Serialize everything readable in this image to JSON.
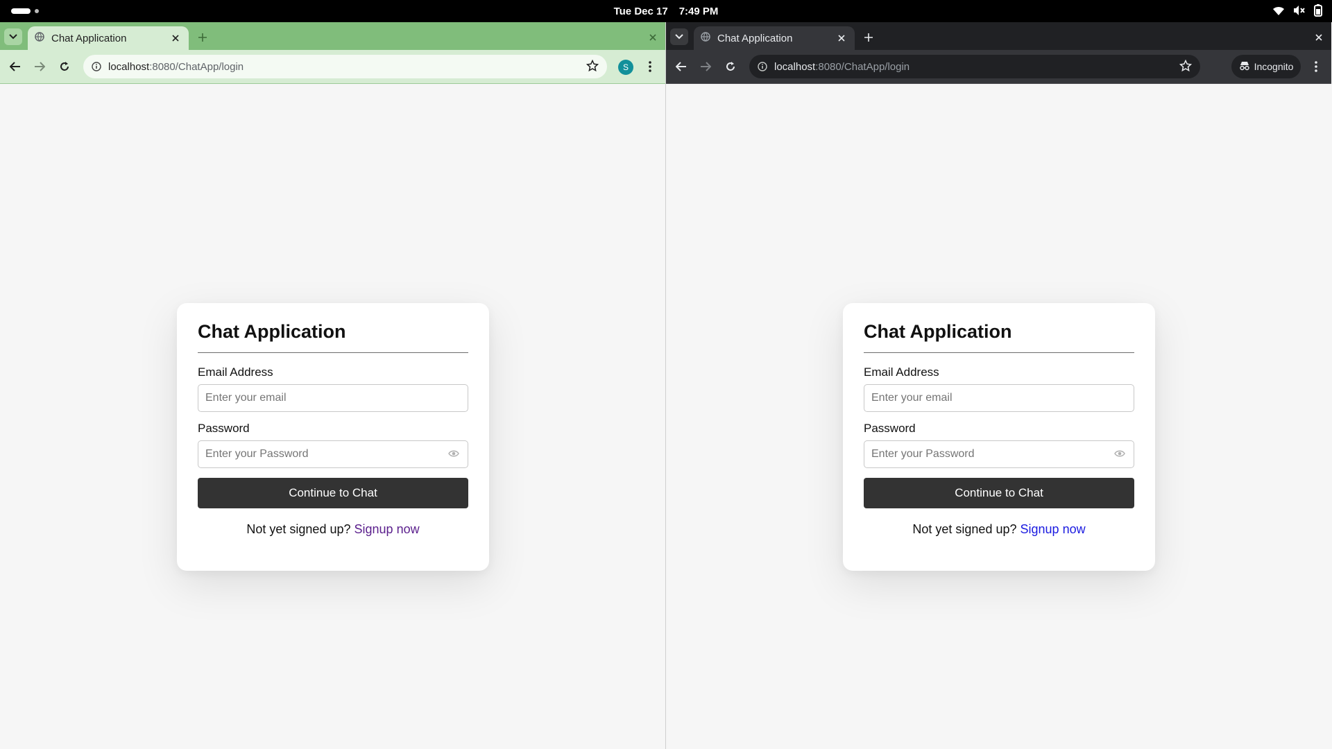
{
  "system": {
    "date": "Tue Dec 17",
    "time": "7:49 PM"
  },
  "windows": [
    {
      "tab_title": "Chat Application",
      "url_host": "localhost",
      "url_path": ":8080/ChatApp/login",
      "profile_initial": "S",
      "accent_color": "#80bd7b",
      "signup_link_color": "#5a1e8c"
    },
    {
      "tab_title": "Chat Application",
      "url_host": "localhost",
      "url_path": ":8080/ChatApp/login",
      "incognito_label": "Incognito",
      "accent_color": "#202124",
      "signup_link_color": "#1a1ae0"
    }
  ],
  "login": {
    "title": "Chat Application",
    "email_label": "Email Address",
    "email_placeholder": "Enter your email",
    "password_label": "Password",
    "password_placeholder": "Enter your Password",
    "submit_label": "Continue to Chat",
    "signup_prompt": "Not yet signed up?",
    "signup_link": "Signup now"
  },
  "icons": [
    "wifi-icon",
    "volume-muted-icon",
    "battery-icon",
    "tab-search-icon",
    "globe-icon",
    "close-icon",
    "plus-icon",
    "back-icon",
    "forward-icon",
    "reload-icon",
    "site-info-icon",
    "star-icon",
    "kebab-menu-icon",
    "incognito-icon",
    "eye-icon"
  ]
}
